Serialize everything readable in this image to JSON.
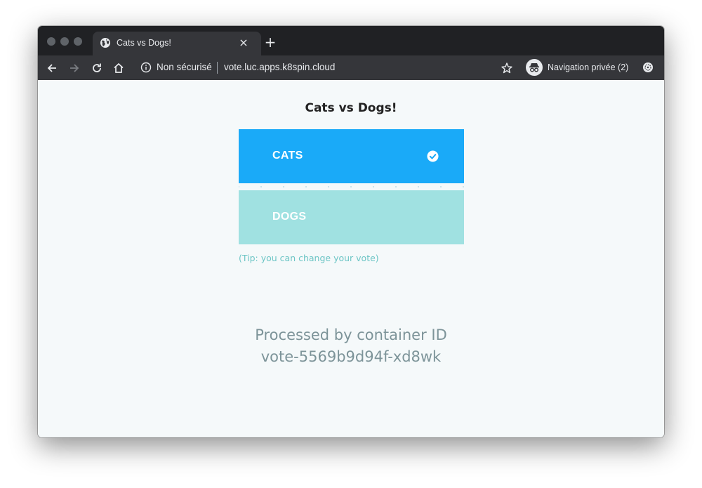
{
  "browser": {
    "tab_title": "Cats vs Dogs!",
    "tab_close": "×",
    "new_tab": "+",
    "security_label": "Non sécurisé",
    "url": "vote.luc.apps.k8spin.cloud",
    "profile_label": "Navigation privée (2)"
  },
  "page": {
    "title": "Cats vs Dogs!",
    "option_a": "CATS",
    "option_b": "DOGS",
    "tip": "(Tip: you can change your vote)",
    "processed_line1": "Processed by container ID",
    "processed_line2": "vote-5569b9d94f-xd8wk"
  },
  "colors": {
    "option_a_selected": "#1aaaf8",
    "option_b": "#a0e1e1",
    "toolbar": "#35363a",
    "titlebar": "#202124"
  },
  "icons": [
    "globe-icon",
    "close-icon",
    "plus-icon",
    "back-icon",
    "forward-icon",
    "reload-icon",
    "home-icon",
    "info-icon",
    "star-icon",
    "incognito-icon",
    "extension-icon",
    "check-circle-icon"
  ]
}
